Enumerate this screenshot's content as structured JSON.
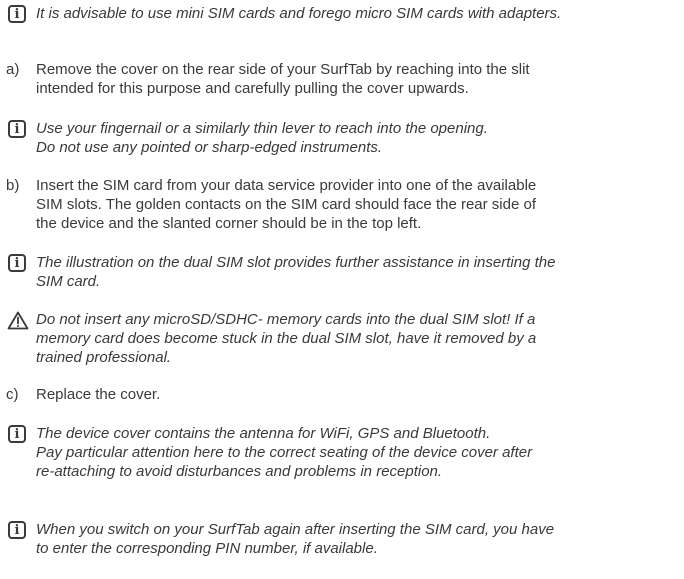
{
  "notes": {
    "n1": [
      "It is advisable to use mini SIM cards and forego micro SIM cards with adapters."
    ],
    "n2": [
      "Use your fingernail or a similarly thin lever to reach into the opening.",
      "Do not use any pointed or sharp-edged instruments."
    ],
    "n3": [
      "The illustration on the dual SIM slot provides further assistance in inserting the",
      "SIM card."
    ],
    "warn": [
      "Do not insert any microSD/SDHC- memory cards into the dual SIM slot! If a",
      "memory card does become stuck in the dual SIM slot, have it removed by a",
      "trained professional."
    ],
    "n4": [
      "The device cover contains the antenna for WiFi, GPS and Bluetooth.",
      "Pay particular attention here to the correct seating of the device cover after",
      "re-attaching to avoid disturbances and problems in reception."
    ],
    "n5": [
      "When you switch on your SurfTab again after inserting the SIM card, you have",
      "to enter the corresponding PIN number, if available."
    ]
  },
  "steps": {
    "a": {
      "letter": "a)",
      "lines": [
        "Remove the cover on the rear side of your SurfTab by reaching into the slit",
        "intended for this purpose and carefully pulling the cover upwards."
      ]
    },
    "b": {
      "letter": "b)",
      "lines": [
        "Insert the SIM card from your data service provider into one of the available",
        "SIM slots. The golden contacts on the SIM card should face the rear side of",
        "the device and the slanted corner should be in the top left."
      ]
    },
    "c": {
      "letter": "c)",
      "lines": [
        "Replace the cover."
      ]
    }
  },
  "icons": {
    "info_glyph": "i",
    "info": "info-icon",
    "warning": "warning-icon"
  },
  "colors": {
    "text": "#3a3a3a"
  }
}
